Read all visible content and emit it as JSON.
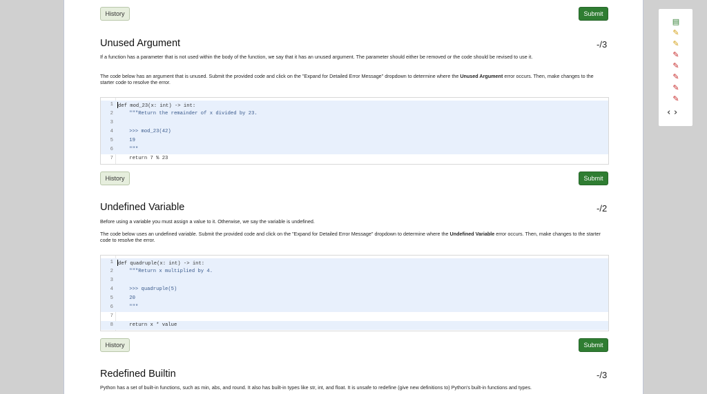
{
  "buttons": {
    "history": "History",
    "submit": "Submit"
  },
  "exercises": [
    {
      "title": "Unused Argument",
      "score": "-/3",
      "para1": "If a function has a parameter that is not used within the body of the function, we say that it has an unused argument. The parameter should either be removed or the code should be revised to use it.",
      "para2_pre": "The code below has an argument that is unused. Submit the provided code and click on the \"Expand for Detailed Error Message\" dropdown to determine where the ",
      "para2_bold": "Unused Argument",
      "para2_post": " error occurs. Then, make changes to the starter code to resolve the error.",
      "code": [
        "def mod_23(x: int) -> int:",
        "    \"\"\"Return the remainder of x divided by 23.",
        "",
        "    >>> mod_23(42)",
        "    19",
        "    \"\"\"",
        "    return 7 % 23"
      ]
    },
    {
      "title": "Undefined Variable",
      "score": "-/2",
      "para1": "Before using a variable you must assign a value to it. Otherwise, we say the variable is undefined.",
      "para2_pre": "The code below uses an undefined variable. Submit the provided code and click on the \"Expand for Detailed Error Message\" dropdown to determine where the ",
      "para2_bold": "Undefined Variable",
      "para2_post": " error occurs. Then, make changes to the starter code to resolve the error.",
      "code": [
        "def quadruple(x: int) -> int:",
        "    \"\"\"Return x multiplied by 4.",
        "",
        "    >>> quadruple(5)",
        "    20",
        "    \"\"\"",
        "",
        "    return x * value"
      ]
    },
    {
      "title": "Redefined Builtin",
      "score": "-/3",
      "para1": "Python has a set of built-in functions, such as min, abs, and round. It also has built-in types like str, int, and float. It is unsafe to redefine (give new definitions to) Python's built-in functions and types."
    }
  ],
  "sidebar": {
    "icons": [
      {
        "name": "film-icon",
        "glyph": "▤",
        "color": "#2f7d32"
      },
      {
        "name": "edit-icon",
        "glyph": "✎",
        "color": "#d4a017"
      },
      {
        "name": "edit-icon",
        "glyph": "✎",
        "color": "#d4a017"
      },
      {
        "name": "edit-icon",
        "glyph": "✎",
        "color": "#c62828"
      },
      {
        "name": "edit-icon",
        "glyph": "✎",
        "color": "#c62828"
      },
      {
        "name": "edit-icon",
        "glyph": "✎",
        "color": "#c62828"
      },
      {
        "name": "edit-icon",
        "glyph": "✎",
        "color": "#c62828"
      },
      {
        "name": "edit-icon",
        "glyph": "✎",
        "color": "#c62828"
      }
    ],
    "prev": "‹",
    "next": "›"
  }
}
